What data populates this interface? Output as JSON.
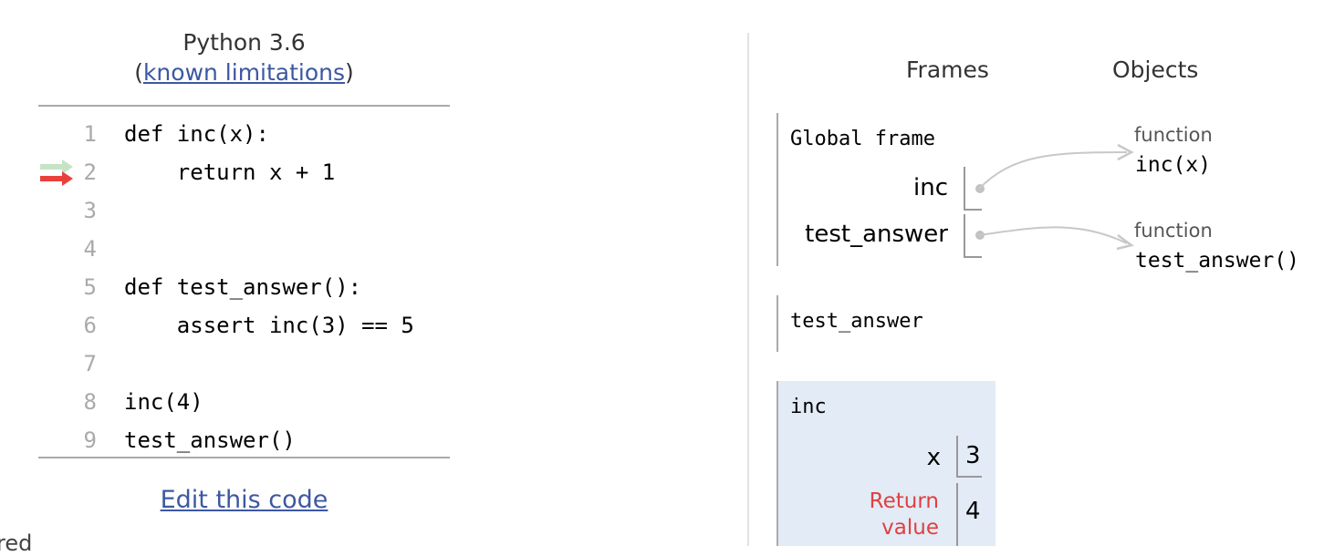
{
  "header": {
    "language": "Python 3.6",
    "paren_open": "(",
    "limitations_link": "known limitations",
    "paren_close": ")"
  },
  "code": {
    "lines": [
      {
        "num": "1",
        "text": "def inc(x):"
      },
      {
        "num": "2",
        "text": "    return x + 1"
      },
      {
        "num": "3",
        "text": ""
      },
      {
        "num": "4",
        "text": ""
      },
      {
        "num": "5",
        "text": "def test_answer():"
      },
      {
        "num": "6",
        "text": "    assert inc(3) == 5"
      },
      {
        "num": "7",
        "text": ""
      },
      {
        "num": "8",
        "text": "inc(4)"
      },
      {
        "num": "9",
        "text": "test_answer()"
      }
    ],
    "prev_line_arrow_color": "#c6e3c6",
    "next_line_arrow_color": "#e8413b"
  },
  "edit_link": "Edit this code",
  "footer_fragment": "red",
  "viz": {
    "frames_header": "Frames",
    "objects_header": "Objects",
    "global_frame": {
      "title": "Global frame",
      "vars": [
        {
          "name": "inc"
        },
        {
          "name": "test_answer"
        }
      ]
    },
    "frames": [
      {
        "title": "test_answer"
      },
      {
        "title": "inc",
        "vars": [
          {
            "name": "x",
            "value": "3"
          }
        ],
        "return_label_1": "Return",
        "return_label_2": "value",
        "return_value": "4"
      }
    ],
    "objects": [
      {
        "type": "function",
        "value": "inc(x)"
      },
      {
        "type": "function",
        "value": "test_answer()"
      }
    ],
    "colors": {
      "link": "#3d58a2",
      "active_frame_bg": "#e2ebf6",
      "return_label": "#e04040",
      "pointer": "#c2c2c2"
    }
  }
}
